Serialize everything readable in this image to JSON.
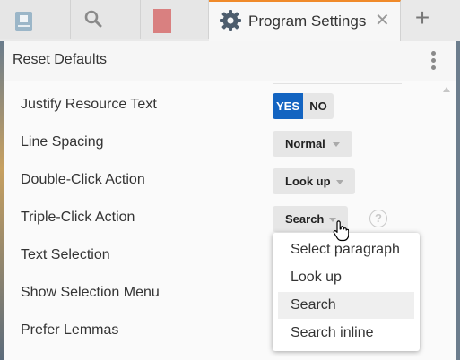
{
  "tabs": [
    {
      "name": "book-tab"
    },
    {
      "name": "search-tab",
      "icon": "search-icon"
    },
    {
      "name": "red-tab"
    },
    {
      "name": "program-settings-tab",
      "label": "Program Settings",
      "close": "✕",
      "icon": "gear-icon"
    }
  ],
  "new_tab_label": "+",
  "header": {
    "reset_label": "Reset Defaults"
  },
  "settings": {
    "justify": {
      "label": "Justify Resource Text",
      "yes": "YES",
      "no": "NO",
      "value": "YES"
    },
    "line_spacing": {
      "label": "Line Spacing",
      "value": "Normal"
    },
    "double_click": {
      "label": "Double-Click Action",
      "value": "Look up"
    },
    "triple_click": {
      "label": "Triple-Click Action",
      "value": "Search"
    },
    "text_selection": {
      "label": "Text Selection"
    },
    "show_selection_menu": {
      "label": "Show Selection Menu"
    },
    "prefer_lemmas": {
      "label": "Prefer Lemmas"
    }
  },
  "help_label": "?",
  "dropdown_menu": {
    "items": [
      "Select paragraph",
      "Look up",
      "Search",
      "Search inline"
    ],
    "highlighted": "Search"
  },
  "colors": {
    "accent": "#1364c1",
    "tab_accent": "#f08a2a"
  }
}
